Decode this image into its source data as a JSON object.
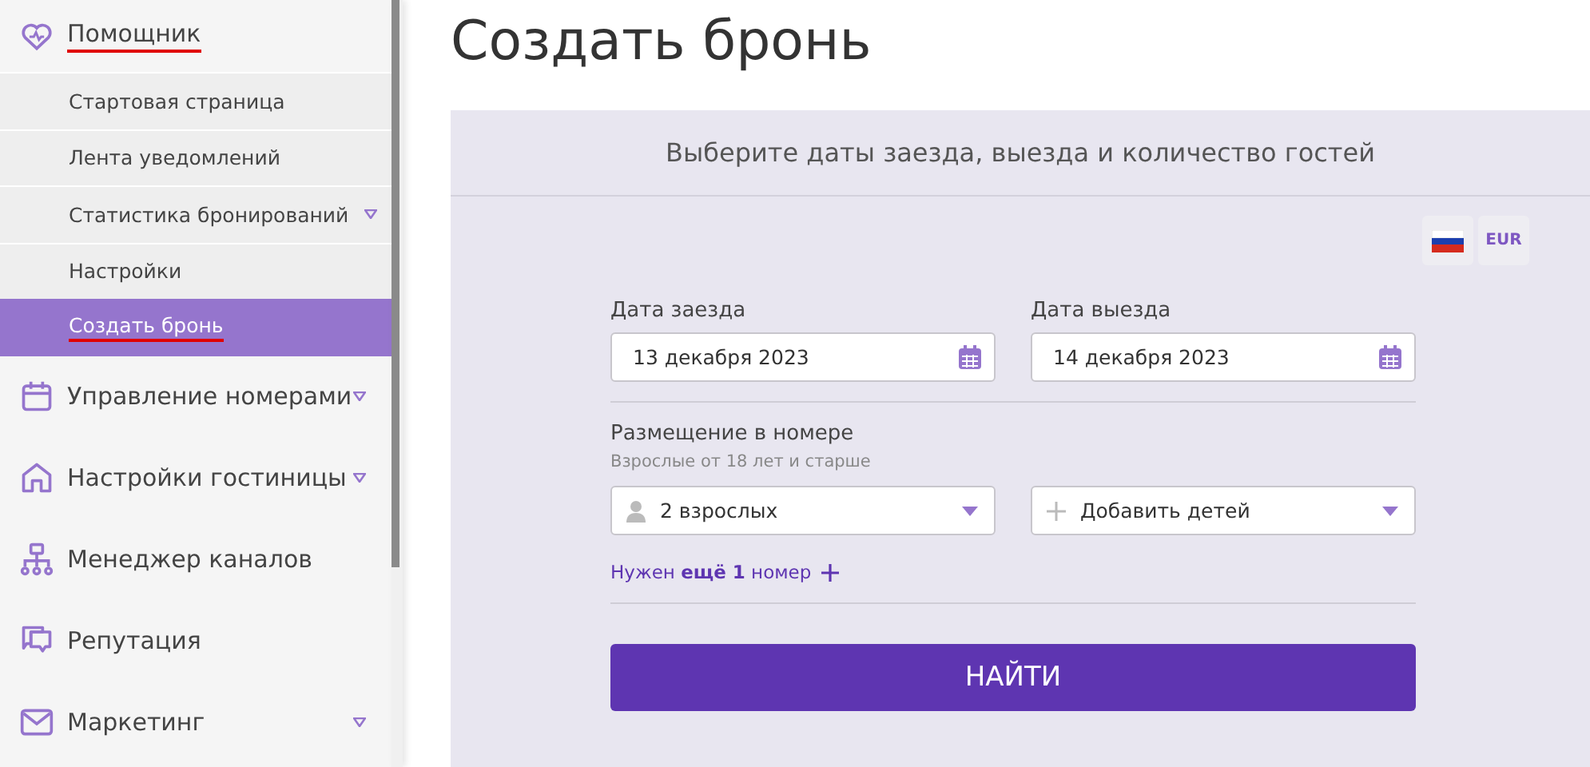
{
  "sidebar": {
    "items": [
      {
        "label": "Помощник",
        "has_submenu": false,
        "underlined": true,
        "children": [
          {
            "label": "Стартовая страница",
            "selected": false,
            "has_submenu": false,
            "underlined": false
          },
          {
            "label": "Лента уведомлений",
            "selected": false,
            "has_submenu": false,
            "underlined": false
          },
          {
            "label": "Статистика бронирований",
            "selected": false,
            "has_submenu": true,
            "underlined": false
          },
          {
            "label": "Настройки",
            "selected": false,
            "has_submenu": false,
            "underlined": false
          },
          {
            "label": "Создать бронь",
            "selected": true,
            "has_submenu": false,
            "underlined": true
          }
        ]
      },
      {
        "label": "Управление номерами",
        "has_submenu": true,
        "underlined": false
      },
      {
        "label": "Настройки гостиницы",
        "has_submenu": true,
        "underlined": false
      },
      {
        "label": "Менеджер каналов",
        "has_submenu": false,
        "underlined": false
      },
      {
        "label": "Репутация",
        "has_submenu": false,
        "underlined": false
      },
      {
        "label": "Маркетинг",
        "has_submenu": true,
        "underlined": false
      }
    ]
  },
  "page_title": "Создать бронь",
  "panel": {
    "heading": "Выберите даты заезда, выезда и количество гостей",
    "currency": "EUR",
    "dates": [
      {
        "label": "Дата заезда",
        "value": "13 декабря 2023"
      },
      {
        "label": "Дата выезда",
        "value": "14 декабря 2023"
      }
    ],
    "accommodation": {
      "label": "Размещение в номере",
      "hint": "Взрослые от 18 лет и старше",
      "selects": [
        {
          "kind": "adults",
          "value": "2 взрослых"
        },
        {
          "kind": "children",
          "value": "Добавить детей"
        }
      ],
      "add_room": "Нужен **ещё 1** номер"
    },
    "search_button": "НАЙТИ"
  }
}
